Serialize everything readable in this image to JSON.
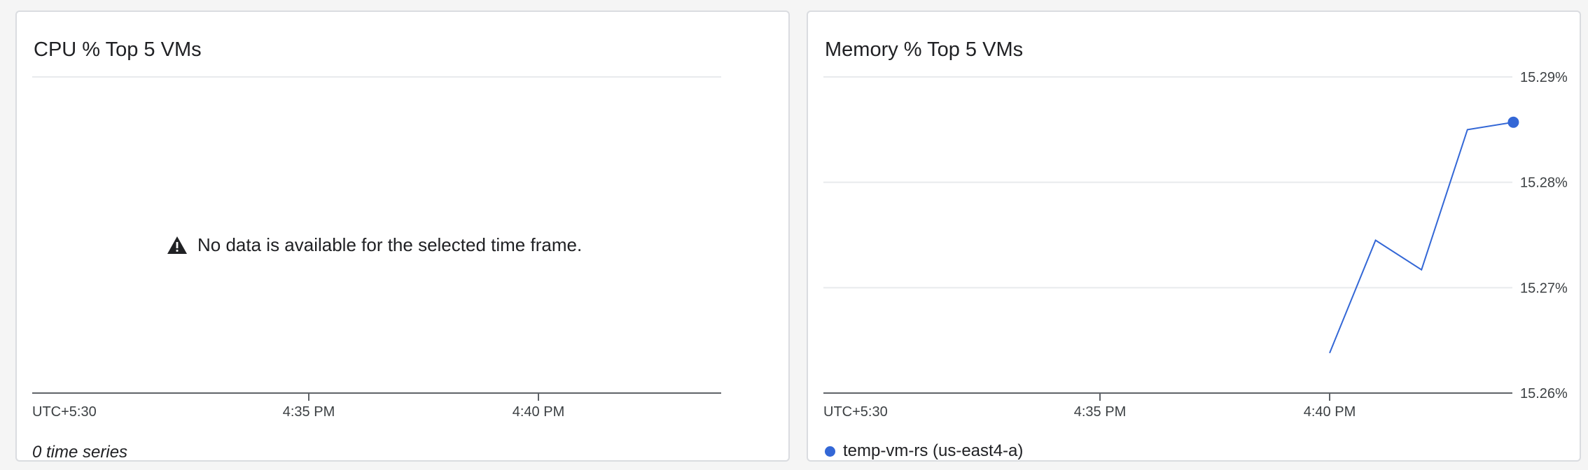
{
  "cpu_card": {
    "title": "CPU % Top 5 VMs",
    "empty_message": "No data is available for the selected time frame.",
    "footer": "0 time series",
    "x_ticks": [
      "UTC+5:30",
      "4:35 PM",
      "4:40 PM"
    ],
    "chart_data": {
      "type": "line",
      "title": "CPU % Top 5 VMs",
      "series": [],
      "x_ticks": [
        "UTC+5:30",
        "4:35 PM",
        "4:40 PM"
      ]
    }
  },
  "memory_card": {
    "title": "Memory % Top 5 VMs",
    "x_ticks": [
      "UTC+5:30",
      "4:35 PM",
      "4:40 PM"
    ],
    "y_ticks": [
      "15.29%",
      "15.28%",
      "15.27%",
      "15.26%"
    ],
    "legend_label": "temp-vm-rs (us-east4-a)",
    "series_color": "#3367d6",
    "chart_data": {
      "type": "line",
      "title": "Memory % Top 5 VMs",
      "x_unit": "minutes",
      "xlim": [
        "4:29 PM",
        "4:44 PM"
      ],
      "ylim": [
        15.26,
        15.29
      ],
      "y_tick_values": [
        15.26,
        15.27,
        15.28,
        15.29
      ],
      "series": [
        {
          "name": "temp-vm-rs (us-east4-a)",
          "color": "#3367d6",
          "x": [
            "4:40 PM",
            "4:41 PM",
            "4:42 PM",
            "4:43 PM",
            "4:44 PM"
          ],
          "y": [
            15.2638,
            15.2745,
            15.2717,
            15.285,
            15.2857
          ]
        }
      ],
      "grid": true,
      "legend_position": "bottom-left"
    }
  }
}
